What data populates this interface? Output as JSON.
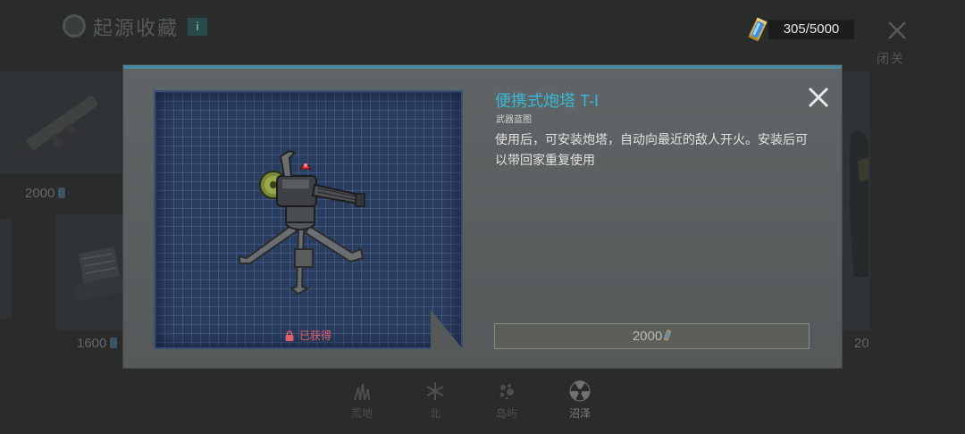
{
  "header": {
    "title": "起源收藏",
    "info_label": "i",
    "currency_value": "305/5000",
    "close_label": "关闭"
  },
  "background_items": [
    {
      "price": "2000"
    },
    {
      "price": "1600"
    },
    {
      "price": "20"
    }
  ],
  "tabs": [
    {
      "label": "荒地",
      "icon": "grass-icon",
      "active": false
    },
    {
      "label": "北",
      "icon": "snowflake-icon",
      "active": false
    },
    {
      "label": "岛屿",
      "icon": "splash-icon",
      "active": false
    },
    {
      "label": "沼泽",
      "icon": "radiation-icon",
      "active": true
    }
  ],
  "modal": {
    "title": "便携式炮塔 T-I",
    "type": "武器蓝图",
    "description": "使用后，可安装炮塔，自动向最近的敌人开火。安装后可以带回家重复使用",
    "status": "已获得",
    "price": "2000"
  },
  "colors": {
    "accent_title": "#39b8d6",
    "status_acquired": "#e2606a",
    "blueprint_bg": "#2b3d5f"
  }
}
